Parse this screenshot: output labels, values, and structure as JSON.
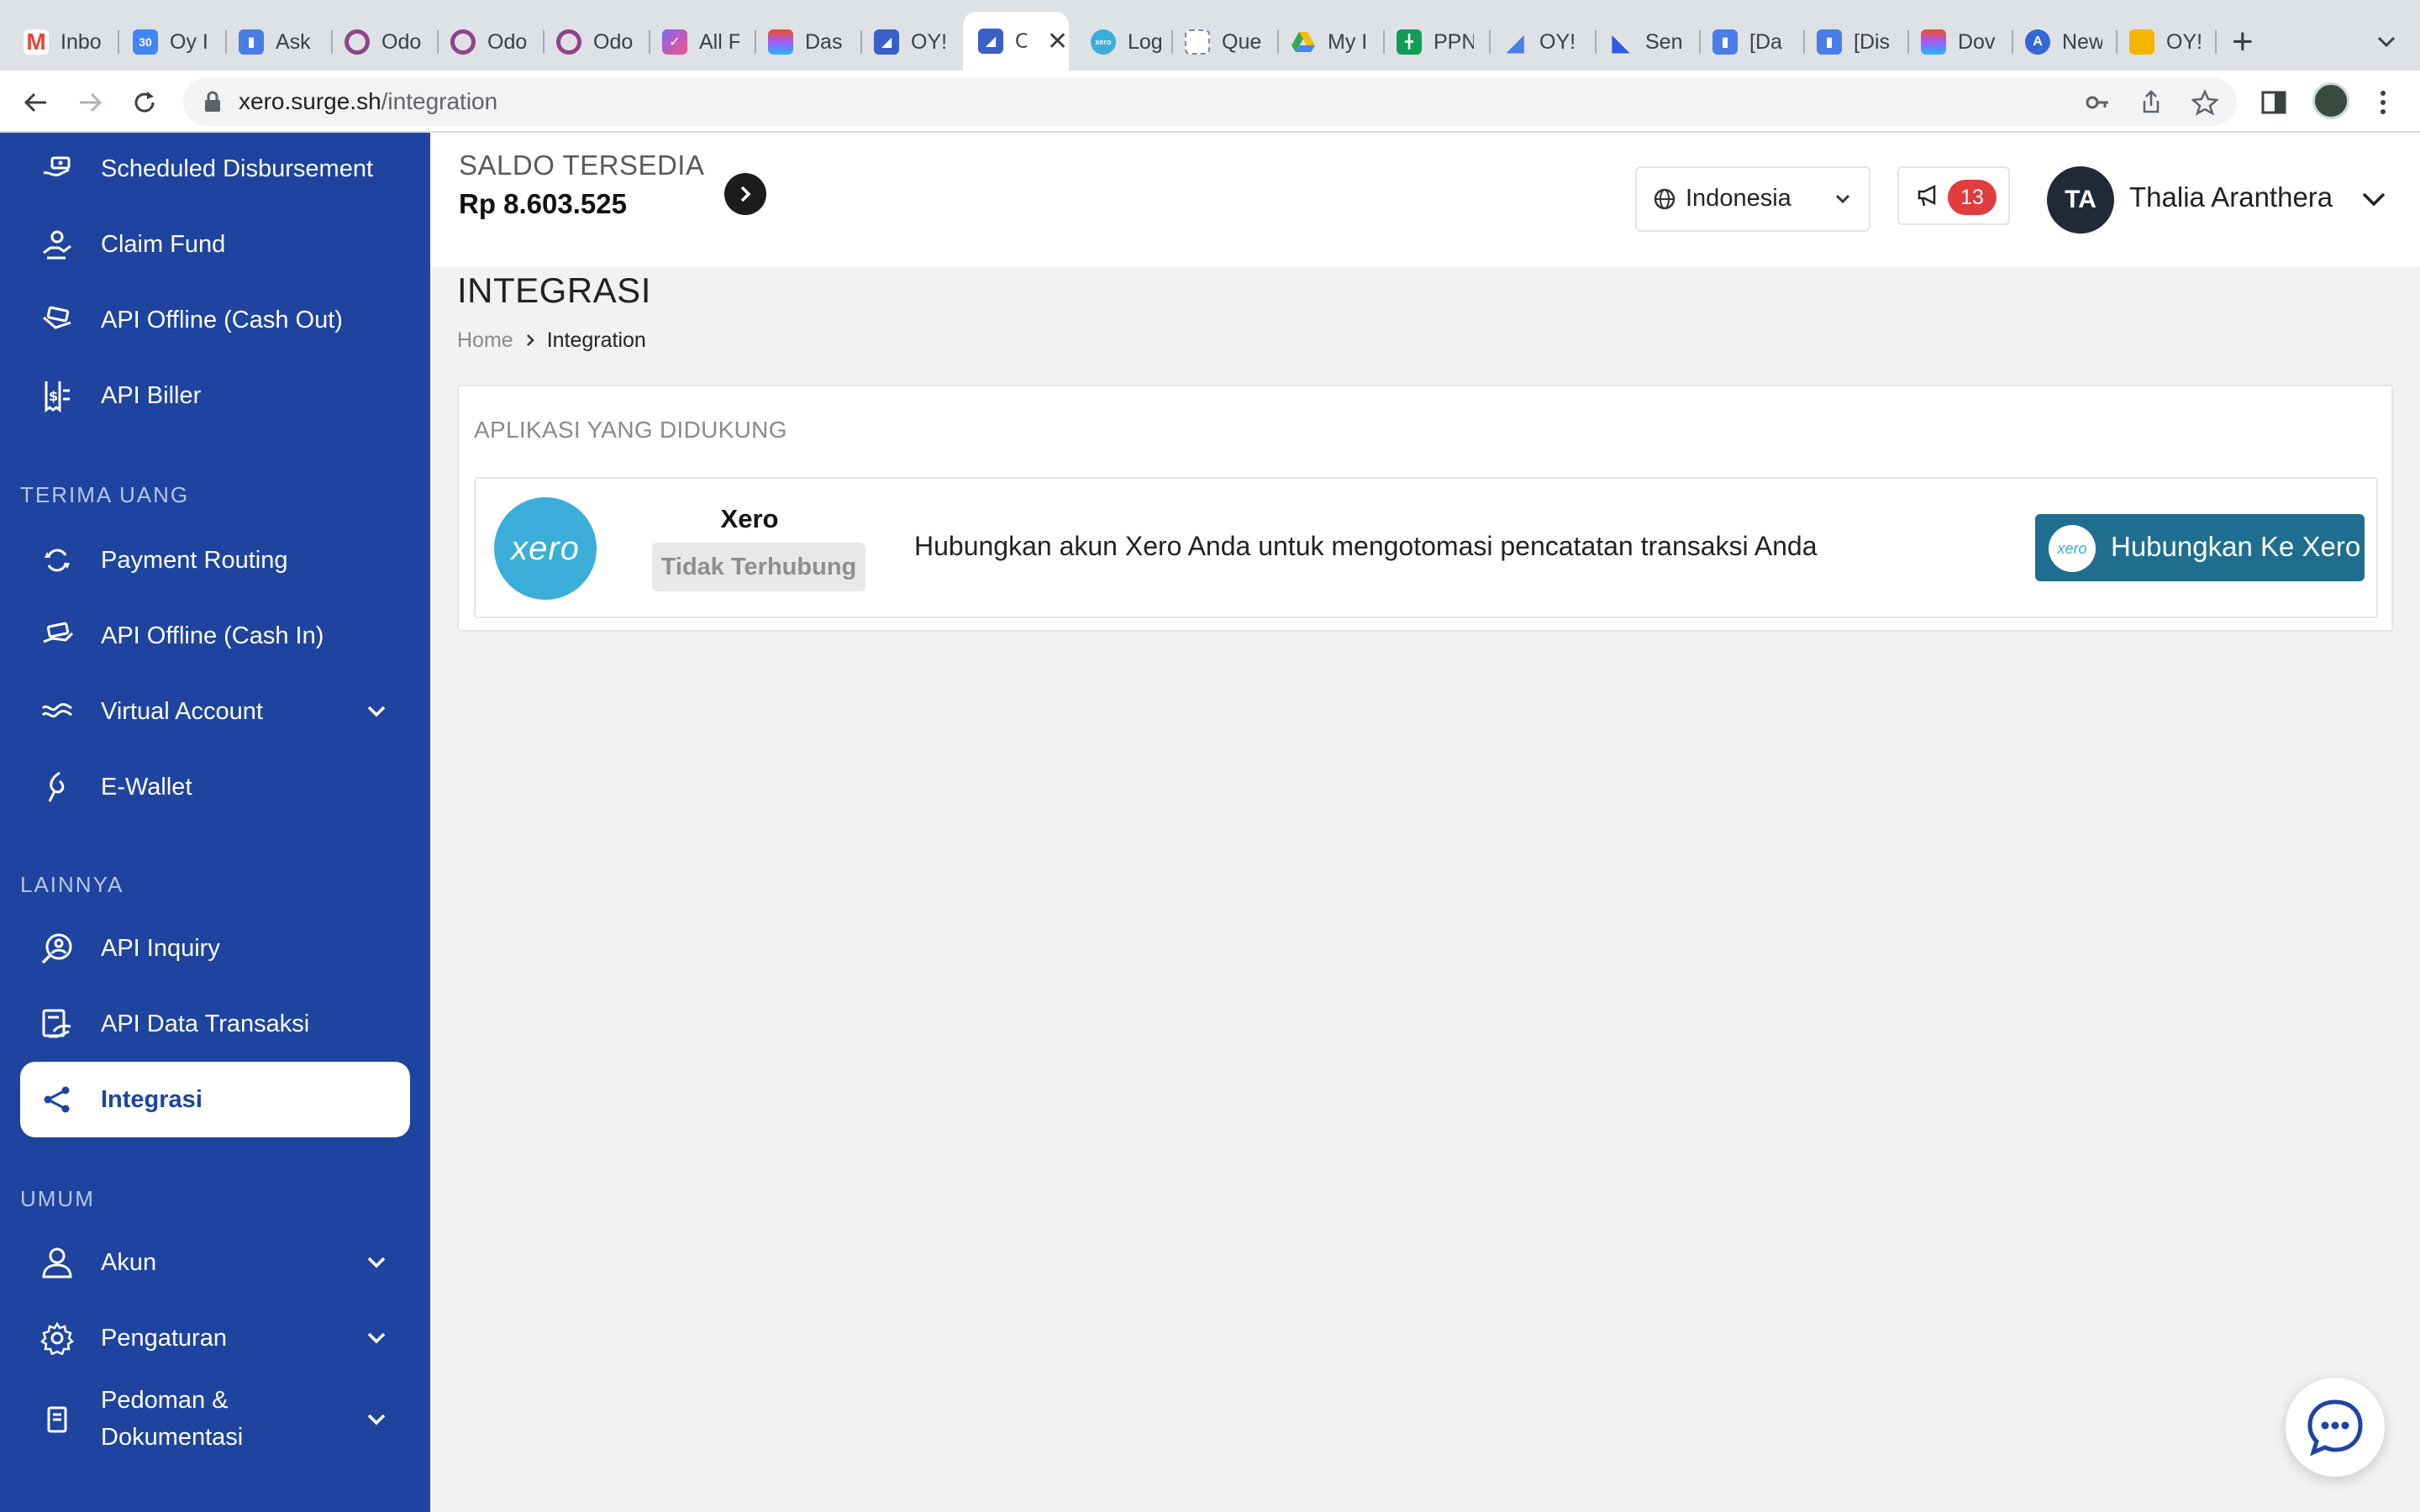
{
  "browser": {
    "tabs": [
      {
        "title": "Inbo",
        "icon": "gmail-icon",
        "color": "#ea4335"
      },
      {
        "title": "Oy I",
        "icon": "calendar-icon",
        "color": "#4285f4"
      },
      {
        "title": "Ask",
        "icon": "doc-icon",
        "color": "#4a7de8"
      },
      {
        "title": "Odo",
        "icon": "odoo-icon",
        "color": "#8e4585"
      },
      {
        "title": "Odo",
        "icon": "odoo-icon",
        "color": "#8e4585"
      },
      {
        "title": "Odo",
        "icon": "odoo-icon",
        "color": "#8e4585"
      },
      {
        "title": "All F",
        "icon": "clickup-icon",
        "color": "#7b68ee"
      },
      {
        "title": "Das",
        "icon": "figma-icon",
        "color": "#f24e1e"
      },
      {
        "title": "OY!",
        "icon": "oy-icon",
        "color": "#3b5fc9"
      },
      {
        "title": "O",
        "icon": "oy-icon",
        "color": "#3b5fc9",
        "active": true
      },
      {
        "title": "Log",
        "icon": "xero-icon",
        "color": "#3aaed8"
      },
      {
        "title": "Que",
        "icon": "grid-icon",
        "color": "#7a86b8"
      },
      {
        "title": "My I",
        "icon": "drive-icon",
        "color": "#34a853"
      },
      {
        "title": "PPN",
        "icon": "sheets-icon",
        "color": "#0f9d58"
      },
      {
        "title": "OY!",
        "icon": "oy-icon",
        "color": "#4a7de8"
      },
      {
        "title": "Sen",
        "icon": "oy-icon",
        "color": "#2d5be3"
      },
      {
        "title": "[Da",
        "icon": "doc-icon",
        "color": "#4a7de8"
      },
      {
        "title": "[Dis",
        "icon": "doc-icon",
        "color": "#4a7de8"
      },
      {
        "title": "Dov",
        "icon": "figma-icon",
        "color": "#f24e1e"
      },
      {
        "title": "New",
        "icon": "new-icon",
        "color": "#3367d6"
      },
      {
        "title": "OY!",
        "icon": "slides-icon",
        "color": "#f4b400"
      }
    ],
    "url_host": "xero.surge.sh",
    "url_path": "/integration"
  },
  "sidebar": {
    "items_top": [
      {
        "label": "Scheduled Disbursement",
        "icon": "scheduled-disbursement-icon"
      },
      {
        "label": "Claim Fund",
        "icon": "claim-fund-icon"
      },
      {
        "label": "API Offline (Cash Out)",
        "icon": "cash-out-icon"
      },
      {
        "label": "API Biller",
        "icon": "biller-icon"
      }
    ],
    "section_terima": "TERIMA UANG",
    "items_terima": [
      {
        "label": "Payment Routing",
        "icon": "payment-routing-icon"
      },
      {
        "label": "API Offline (Cash In)",
        "icon": "cash-in-icon"
      },
      {
        "label": "Virtual Account",
        "icon": "virtual-account-icon"
      },
      {
        "label": "E-Wallet",
        "icon": "ewallet-icon"
      }
    ],
    "section_lainnya": "LAINNYA",
    "items_lainnya": [
      {
        "label": "API Inquiry",
        "icon": "inquiry-icon"
      },
      {
        "label": "API Data Transaksi",
        "icon": "data-transaksi-icon"
      },
      {
        "label": "Integrasi",
        "icon": "share-icon"
      }
    ],
    "section_umum": "UMUM",
    "items_umum": [
      {
        "label": "Akun",
        "icon": "user-icon"
      },
      {
        "label": "Pengaturan",
        "icon": "gear-icon"
      },
      {
        "label": "Pedoman &",
        "label2": "Dokumentasi",
        "icon": "book-icon"
      }
    ]
  },
  "header": {
    "saldo_label": "SALDO TERSEDIA",
    "saldo_value": "Rp 8.603.525",
    "language": "Indonesia",
    "notification_count": "13",
    "user_initials": "TA",
    "user_name": "Thalia Aranthera"
  },
  "main": {
    "title": "INTEGRASI",
    "breadcrumb_home": "Home",
    "breadcrumb_current": "Integration",
    "card_title": "APLIKASI YANG DIDUKUNG",
    "app": {
      "logo_text": "xero",
      "name": "Xero",
      "status": "Tidak Terhubung",
      "description": "Hubungkan akun Xero Anda untuk mengotomasi pencatatan transaksi Anda",
      "connect_label": "Hubungkan Ke Xero"
    }
  },
  "colors": {
    "sidebar_bg": "#1e44a0",
    "connect_button": "#1f6e8f",
    "xero_brand": "#3aaed8",
    "badge_red": "#e23d3d"
  }
}
